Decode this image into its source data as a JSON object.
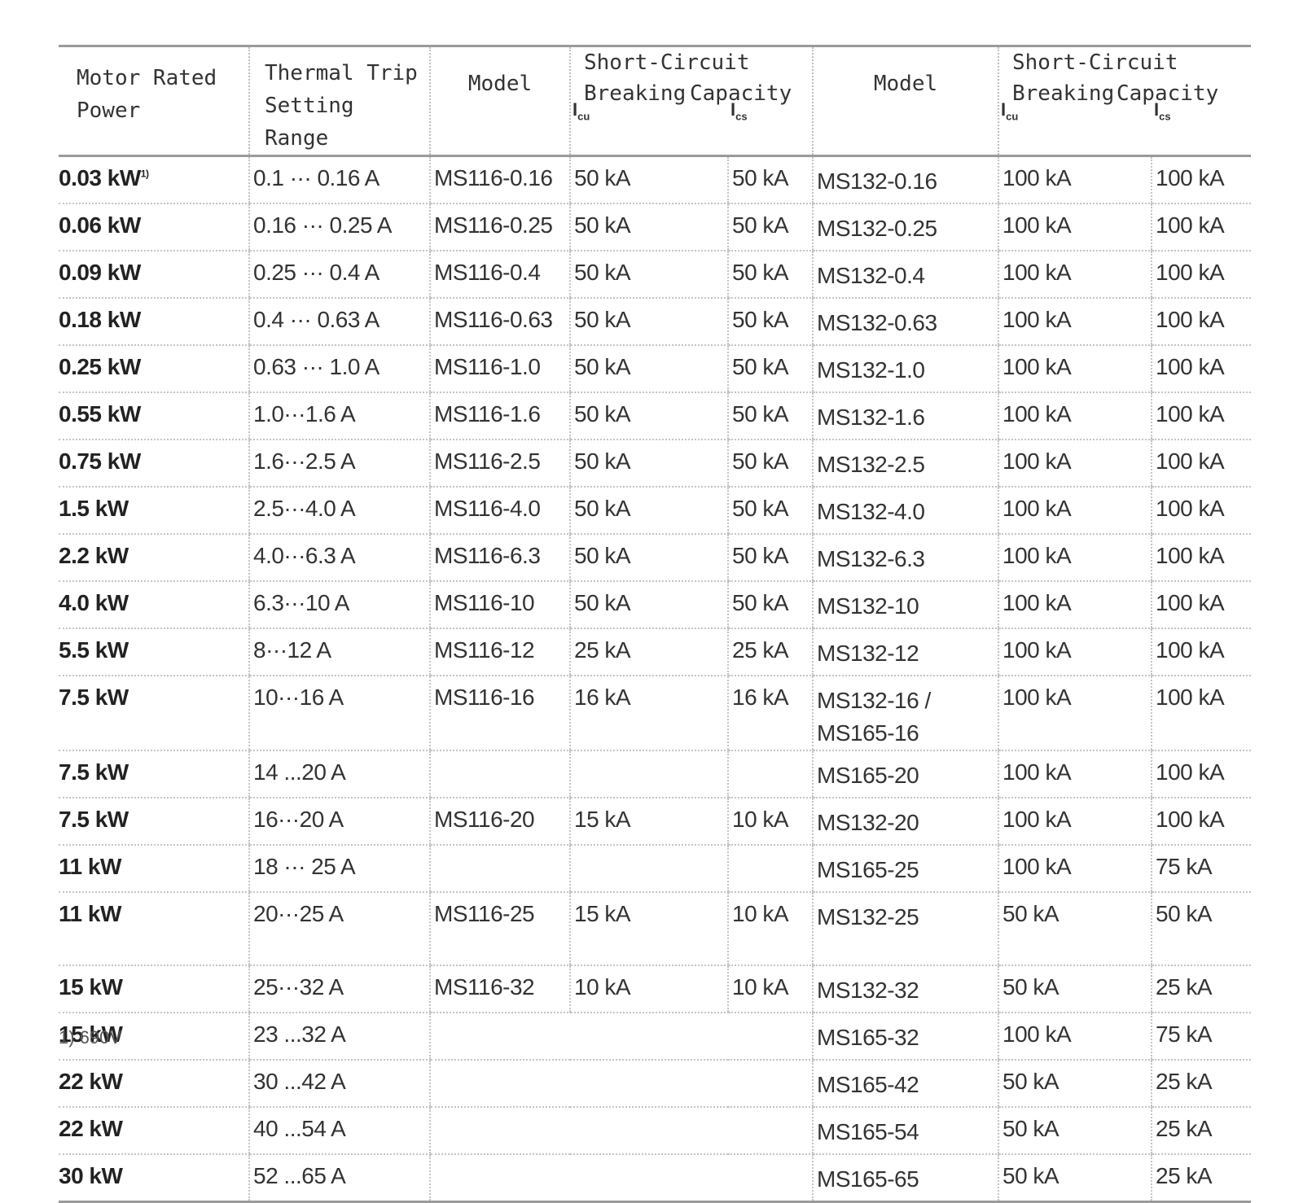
{
  "header": {
    "motor_rated_power": "Motor Rated Power",
    "motor_line1": "Motor  Rated",
    "motor_line2": "Power",
    "thermal_line1": "Thermal  Trip",
    "thermal_line2": "Setting  Range",
    "model": "Model",
    "sc_title": "Short-Circuit",
    "sc_breaking": "Breaking",
    "sc_capacity": "Capacity",
    "icu": "I",
    "icu_sub": "cu",
    "ics": "I",
    "ics_sub": "cs"
  },
  "rows": [
    {
      "power": "0.03 kW",
      "power_note": "1)",
      "range": "0.1 ··· 0.16 A",
      "ms116": "MS116-0.16",
      "icu116": "50 kA",
      "ics116": "50 kA",
      "ms2": "MS132-0.16",
      "ms2b": "",
      "icu2": "100 kA",
      "ics2": "100 kA"
    },
    {
      "power": "0.06 kW",
      "power_note": "",
      "range": "0.16 ··· 0.25 A",
      "ms116": "MS116-0.25",
      "icu116": "50 kA",
      "ics116": "50 kA",
      "ms2": "MS132-0.25",
      "ms2b": "",
      "icu2": "100 kA",
      "ics2": "100 kA"
    },
    {
      "power": "0.09 kW",
      "power_note": "",
      "range": "0.25 ··· 0.4 A",
      "ms116": "MS116-0.4",
      "icu116": "50 kA",
      "ics116": "50 kA",
      "ms2": "MS132-0.4",
      "ms2b": "",
      "icu2": "100 kA",
      "ics2": "100 kA"
    },
    {
      "power": "0.18 kW",
      "power_note": "",
      "range": "0.4 ··· 0.63 A",
      "ms116": "MS116-0.63",
      "icu116": "50 kA",
      "ics116": "50 kA",
      "ms2": "MS132-0.63",
      "ms2b": "",
      "icu2": "100 kA",
      "ics2": "100 kA"
    },
    {
      "power": "0.25 kW",
      "power_note": "",
      "range": "0.63 ··· 1.0 A",
      "ms116": "MS116-1.0",
      "icu116": "50 kA",
      "ics116": "50 kA",
      "ms2": "MS132-1.0",
      "ms2b": "",
      "icu2": "100 kA",
      "ics2": "100 kA"
    },
    {
      "power": "0.55 kW",
      "power_note": "",
      "range": "1.0···1.6 A",
      "ms116": "MS116-1.6",
      "icu116": "50 kA",
      "ics116": "50 kA",
      "ms2": "MS132-1.6",
      "ms2b": "",
      "icu2": "100 kA",
      "ics2": "100 kA"
    },
    {
      "power": "0.75 kW",
      "power_note": "",
      "range": "1.6···2.5 A",
      "ms116": "MS116-2.5",
      "icu116": "50 kA",
      "ics116": "50 kA",
      "ms2": "MS132-2.5",
      "ms2b": "",
      "icu2": "100 kA",
      "ics2": "100 kA"
    },
    {
      "power": "1.5 kW",
      "power_note": "",
      "range": "2.5···4.0 A",
      "ms116": "MS116-4.0",
      "icu116": "50 kA",
      "ics116": "50 kA",
      "ms2": "MS132-4.0",
      "ms2b": "",
      "icu2": "100 kA",
      "ics2": "100 kA"
    },
    {
      "power": "2.2 kW",
      "power_note": "",
      "range": "4.0···6.3 A",
      "ms116": "MS116-6.3",
      "icu116": "50 kA",
      "ics116": "50 kA",
      "ms2": "MS132-6.3",
      "ms2b": "",
      "icu2": "100 kA",
      "ics2": "100 kA"
    },
    {
      "power": "4.0 kW",
      "power_note": "",
      "range": "6.3···10 A",
      "ms116": "MS116-10",
      "icu116": "50 kA",
      "ics116": "50 kA",
      "ms2": "MS132-10",
      "ms2b": "",
      "icu2": "100 kA",
      "ics2": "100 kA"
    },
    {
      "power": "5.5 kW",
      "power_note": "",
      "range": "8···12 A",
      "ms116": "MS116-12",
      "icu116": "25 kA",
      "ics116": "25 kA",
      "ms2": "MS132-12",
      "ms2b": "",
      "icu2": "100 kA",
      "ics2": "100 kA"
    },
    {
      "power": "7.5 kW",
      "power_note": "",
      "range": "10···16 A",
      "ms116": "MS116-16",
      "icu116": "16 kA",
      "ics116": "16 kA",
      "ms2": "MS132-16 /",
      "ms2b": "MS165-16",
      "icu2": "100 kA",
      "ics2": "100 kA"
    },
    {
      "power": "7.5 kW",
      "power_note": "",
      "range": "14 ...20 A",
      "ms116": "",
      "icu116": "",
      "ics116": "",
      "ms2": "MS165-20",
      "ms2b": "",
      "icu2": "100 kA",
      "ics2": "100 kA"
    },
    {
      "power": "7.5 kW",
      "power_note": "",
      "range": "16···20 A",
      "ms116": "MS116-20",
      "icu116": "15 kA",
      "ics116": "10 kA",
      "ms2": "MS132-20",
      "ms2b": "",
      "icu2": "100 kA",
      "ics2": "100 kA"
    },
    {
      "power": "11 kW",
      "power_note": "",
      "range": "18 ··· 25 A",
      "ms116": "",
      "icu116": "",
      "ics116": "",
      "ms2": "MS165-25",
      "ms2b": "",
      "icu2": "100 kA",
      "ics2": "75 kA"
    },
    {
      "power": "11 kW",
      "power_note": "",
      "range": "20···25 A",
      "ms116": "MS116-25",
      "icu116": "15 kA",
      "ics116": "10 kA",
      "ms2": "MS132-25",
      "ms2b": "",
      "icu2": "50 kA",
      "ics2": "50 kA"
    },
    {
      "power": "15 kW",
      "power_note": "",
      "range": "25···32 A",
      "ms116": "MS116-32",
      "icu116": "10 kA",
      "ics116": "10 kA",
      "ms2": "MS132-32",
      "ms2b": "",
      "icu2": "50 kA",
      "ics2": "25 kA"
    },
    {
      "power": "15 kW",
      "power_note": "",
      "range": "23 ...32 A",
      "ms116": "",
      "icu116": "",
      "ics116": "",
      "ms2": "MS165-32",
      "ms2b": "",
      "icu2": "100 kA",
      "ics2": "75 kA"
    },
    {
      "power": "22 kW",
      "power_note": "",
      "range": "30 ...42 A",
      "ms116": "",
      "icu116": "",
      "ics116": "",
      "ms2": "MS165-42",
      "ms2b": "",
      "icu2": "50 kA",
      "ics2": "25 kA"
    },
    {
      "power": "22 kW",
      "power_note": "",
      "range": "40 ...54 A",
      "ms116": "",
      "icu116": "",
      "ics116": "",
      "ms2": "MS165-54",
      "ms2b": "",
      "icu2": "50 kA",
      "ics2": "25 kA"
    },
    {
      "power": "30 kW",
      "power_note": "",
      "range": "52 ...65 A",
      "ms116": "",
      "icu116": "",
      "ics116": "",
      "ms2": "MS165-65",
      "ms2b": "",
      "icu2": "50 kA",
      "ics2": "25 kA"
    }
  ],
  "footnote": "1) 690V"
}
